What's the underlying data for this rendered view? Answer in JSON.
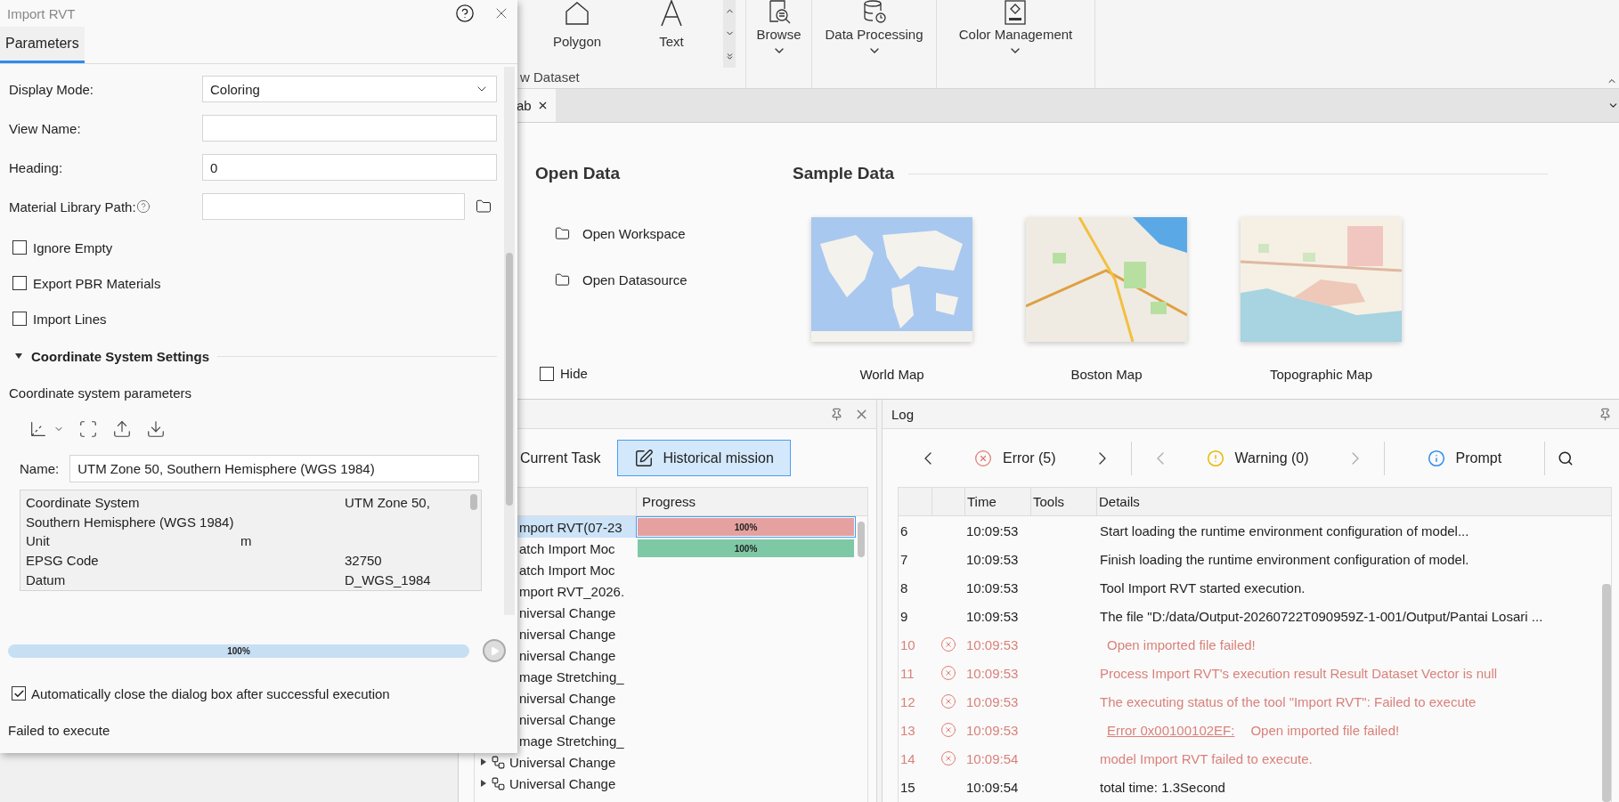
{
  "ribbon": {
    "tools": [
      {
        "label": "Polygon"
      },
      {
        "label": "Text"
      }
    ],
    "group_label": "w Dataset",
    "menus": [
      {
        "label": "Browse"
      },
      {
        "label": "Data Processing"
      },
      {
        "label": "Color Management"
      }
    ]
  },
  "doc_tabs": [
    {
      "label": "ab",
      "selected": true
    }
  ],
  "start_page": {
    "open_title": "Open Data",
    "open_items": [
      "Open Workspace",
      "Open Datasource"
    ],
    "hide": {
      "label": "Hide",
      "checked": false
    },
    "sample_title": "Sample Data",
    "samples": [
      {
        "label": "World Map",
        "kind": "picture"
      },
      {
        "label": "Boston Map",
        "kind": "picture"
      },
      {
        "label": "Topographic Map",
        "kind": "picture"
      }
    ]
  },
  "task_panel": {
    "tabs": [
      {
        "label": "Current Task",
        "selected": false
      },
      {
        "label": "Historical mission",
        "selected": true
      }
    ],
    "columns": [
      "Progress"
    ],
    "rows": [
      {
        "kind": "partial",
        "name": "mport RVT(07-23",
        "selected": true,
        "progress": {
          "level": 1,
          "label": "100%",
          "color": "#e4a19f"
        }
      },
      {
        "kind": "partial",
        "name": "atch Import Moc",
        "selected": false,
        "progress": {
          "level": 1,
          "label": "100%",
          "color": "#7ec8a5"
        }
      },
      {
        "kind": "partial",
        "name": "atch Import Moc",
        "selected": false
      },
      {
        "kind": "partial",
        "name": "mport RVT_2026.",
        "selected": false
      },
      {
        "kind": "partial",
        "name": "niversal Change",
        "selected": false
      },
      {
        "kind": "partial",
        "name": "niversal Change",
        "selected": false
      },
      {
        "kind": "partial",
        "name": "niversal Change",
        "selected": false
      },
      {
        "kind": "partial",
        "name": "mage Stretching_",
        "selected": false
      },
      {
        "kind": "partial",
        "name": "niversal Change",
        "selected": false
      },
      {
        "kind": "partial",
        "name": "niversal Change",
        "selected": false
      },
      {
        "kind": "partial",
        "name": "mage Stretching_",
        "selected": false
      },
      {
        "kind": "node",
        "name": "Universal Change",
        "selected": false
      },
      {
        "kind": "node",
        "name": "Universal Change",
        "selected": false
      }
    ]
  },
  "log": {
    "title": "Log",
    "filters": [
      {
        "kind": "error",
        "label": "Error (5)"
      },
      {
        "kind": "warning",
        "label": "Warning (0)"
      },
      {
        "kind": "prompt",
        "label": "Prompt"
      }
    ],
    "columns": [
      "Time",
      "Tools",
      "Details"
    ],
    "rows": [
      {
        "no": "6",
        "kind": "info",
        "time": "10:09:53",
        "details": "Start loading the runtime environment configuration of model..."
      },
      {
        "no": "7",
        "kind": "info",
        "time": "10:09:53",
        "details": "Finish loading the runtime environment configuration of model."
      },
      {
        "no": "8",
        "kind": "info",
        "time": "10:09:53",
        "details": "Tool Import RVT started execution."
      },
      {
        "no": "9",
        "kind": "info",
        "time": "10:09:53",
        "details": "The file \"D:/data/Output-20260722T090959Z-1-001/Output/Pantai Losari ..."
      },
      {
        "no": "10",
        "kind": "error",
        "time": "10:09:53",
        "details": "Open imported file failed!"
      },
      {
        "no": "11",
        "kind": "error",
        "time": "10:09:53",
        "details": "Process Import RVT's execution result Result Dataset Vector is null"
      },
      {
        "no": "12",
        "kind": "error",
        "time": "10:09:53",
        "details": "The executing status of the tool \"Import RVT\": Failed to execute"
      },
      {
        "no": "13",
        "kind": "error",
        "time": "10:09:53",
        "link": "Error 0x00100102EF:",
        "details": "Open imported file failed!"
      },
      {
        "no": "14",
        "kind": "error",
        "time": "10:09:54",
        "details": "model Import RVT failed to execute."
      },
      {
        "no": "15",
        "kind": "info",
        "time": "10:09:54",
        "details": "total time:  1.3Second"
      }
    ]
  },
  "dialog": {
    "title": "Import RVT",
    "tabs": [
      {
        "label": "Parameters",
        "selected": true
      }
    ],
    "fields": [
      {
        "kind": "select",
        "label": "Display Mode:",
        "value": "Coloring"
      },
      {
        "kind": "text",
        "label": "View Name:"
      },
      {
        "kind": "text",
        "label": "Heading:",
        "value": "0"
      },
      {
        "kind": "path",
        "label": "Material Library Path:"
      }
    ],
    "options": [
      {
        "label": "Ignore Empty",
        "checked": false
      },
      {
        "label": "Export PBR Materials",
        "checked": false
      },
      {
        "label": "Import Lines",
        "checked": false
      }
    ],
    "section": {
      "title": "Coordinate System Settings",
      "expanded": true
    },
    "subtitle": "Coordinate system parameters",
    "name": {
      "label": "Name:",
      "value": "UTM Zone 50, Southern Hemisphere (WGS 1984)"
    },
    "properties": [
      {
        "kind": "pair",
        "name": "Coordinate System",
        "value": "UTM Zone 50,"
      },
      {
        "kind": "line",
        "name": "Southern Hemisphere (WGS 1984)"
      },
      {
        "kind": "mid",
        "name": "Unit",
        "value": "m"
      },
      {
        "kind": "pair",
        "name": "EPSG Code",
        "value": "32750"
      },
      {
        "kind": "pair",
        "name": "Datum",
        "value": "D_WGS_1984"
      }
    ],
    "progress": {
      "level": 1,
      "label": "100%"
    },
    "auto_close": {
      "label": "Automatically close the dialog box after successful execution",
      "checked": true
    },
    "status": "Failed to execute"
  }
}
